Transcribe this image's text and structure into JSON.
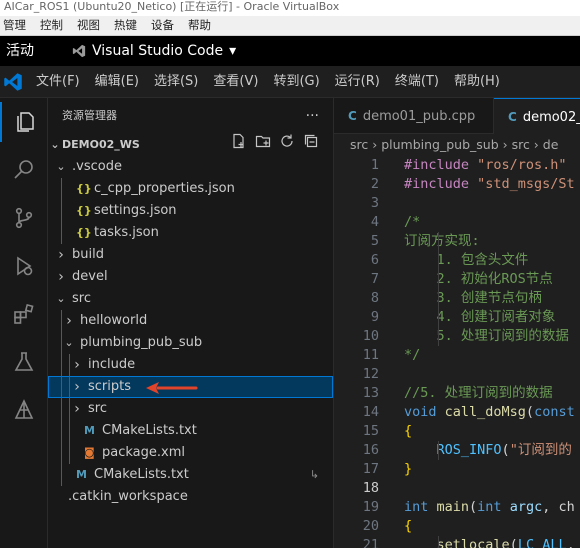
{
  "vbox": {
    "title": "AICar_ROS1 (Ubuntu20_Netico) [正在运行] - Oracle VirtualBox",
    "menu": [
      "管理",
      "控制",
      "视图",
      "热键",
      "设备",
      "帮助"
    ]
  },
  "gnome": {
    "activities": "活动",
    "app_name": "Visual Studio Code",
    "dropdown_glyph": "▾"
  },
  "menubar": [
    "文件(F)",
    "编辑(E)",
    "选择(S)",
    "查看(V)",
    "转到(G)",
    "运行(R)",
    "终端(T)",
    "帮助(H)"
  ],
  "activity_icons": [
    "explorer-icon",
    "search-icon",
    "source-control-icon",
    "run-debug-icon",
    "extensions-icon",
    "testing-icon",
    "ros-icon"
  ],
  "explorer": {
    "title": "资源管理器",
    "more": "···",
    "project": "DEMO02_WS",
    "tree": [
      {
        "name": "vscode-folder",
        "label": ".vscode",
        "kind": "folder",
        "open": true,
        "depth": 1
      },
      {
        "name": "c-cpp-properties-file",
        "label": "c_cpp_properties.json",
        "kind": "json",
        "depth": 2
      },
      {
        "name": "settings-file",
        "label": "settings.json",
        "kind": "json",
        "depth": 2
      },
      {
        "name": "tasks-file",
        "label": "tasks.json",
        "kind": "json",
        "depth": 2
      },
      {
        "name": "build-folder",
        "label": "build",
        "kind": "folder",
        "open": false,
        "depth": 1
      },
      {
        "name": "devel-folder",
        "label": "devel",
        "kind": "folder",
        "open": false,
        "depth": 1
      },
      {
        "name": "src-folder",
        "label": "src",
        "kind": "folder",
        "open": true,
        "depth": 1
      },
      {
        "name": "helloworld-folder",
        "label": "helloworld",
        "kind": "folder",
        "open": false,
        "depth": 2
      },
      {
        "name": "plumbing-pub-sub-folder",
        "label": "plumbing_pub_sub",
        "kind": "folder",
        "open": true,
        "depth": 2
      },
      {
        "name": "include-folder",
        "label": "include",
        "kind": "folder",
        "open": false,
        "depth": 3
      },
      {
        "name": "scripts-folder",
        "label": "scripts",
        "kind": "folder",
        "open": false,
        "depth": 3,
        "selected": true
      },
      {
        "name": "src-subfolder",
        "label": "src",
        "kind": "folder",
        "open": false,
        "depth": 3
      },
      {
        "name": "cmakelists-pkg-file",
        "label": "CMakeLists.txt",
        "kind": "cmake",
        "depth": 3
      },
      {
        "name": "package-xml-file",
        "label": "package.xml",
        "kind": "xml",
        "depth": 3
      },
      {
        "name": "cmakelists-src-file",
        "label": "CMakeLists.txt",
        "kind": "cmake",
        "depth": 2,
        "link": "↳"
      },
      {
        "name": "catkin-workspace-file",
        "label": ".catkin_workspace",
        "kind": "plain",
        "depth": 1
      }
    ]
  },
  "editor": {
    "tabs": [
      {
        "label": "demo01_pub.cpp",
        "icon": "C",
        "active": false
      },
      {
        "label": "demo02_",
        "icon": "C",
        "active": true
      }
    ],
    "breadcrumb": "src › plumbing_pub_sub › src › de",
    "current_line": 18,
    "lines": [
      {
        "n": 1,
        "parts": [
          [
            "#include ",
            "pp"
          ],
          [
            "\"ros/ros.h\"",
            "str"
          ]
        ]
      },
      {
        "n": 2,
        "parts": [
          [
            "#include ",
            "pp"
          ],
          [
            "\"std_msgs/St",
            "str"
          ]
        ]
      },
      {
        "n": 3,
        "parts": []
      },
      {
        "n": 4,
        "parts": [
          [
            "/*",
            "cm"
          ]
        ]
      },
      {
        "n": 5,
        "parts": [
          [
            "订阅方实现:",
            "cm"
          ]
        ]
      },
      {
        "n": 6,
        "parts": [
          [
            "    1. 包含头文件",
            "cm"
          ]
        ]
      },
      {
        "n": 7,
        "parts": [
          [
            "    2. 初始化ROS节点",
            "cm"
          ]
        ]
      },
      {
        "n": 8,
        "parts": [
          [
            "    3. 创建节点句柄",
            "cm"
          ]
        ]
      },
      {
        "n": 9,
        "parts": [
          [
            "    4. 创建订阅者对象",
            "cm"
          ]
        ]
      },
      {
        "n": 10,
        "parts": [
          [
            "    5. 处理订阅到的数据",
            "cm"
          ]
        ]
      },
      {
        "n": 11,
        "parts": [
          [
            "*/",
            "cm"
          ]
        ]
      },
      {
        "n": 12,
        "parts": []
      },
      {
        "n": 13,
        "parts": [
          [
            "//5. 处理订阅到的数据",
            "cm"
          ]
        ]
      },
      {
        "n": 14,
        "parts": [
          [
            "void ",
            "kw"
          ],
          [
            "call_doMsg",
            "fn"
          ],
          [
            "(",
            "pl"
          ],
          [
            "const",
            "kw"
          ]
        ]
      },
      {
        "n": 15,
        "parts": [
          [
            "{",
            "br"
          ]
        ]
      },
      {
        "n": 16,
        "parts": [
          [
            "    ",
            "pl"
          ],
          [
            "ROS_INFO",
            "mac"
          ],
          [
            "(",
            "pl"
          ],
          [
            "\"订阅到的",
            "str"
          ]
        ]
      },
      {
        "n": 17,
        "parts": [
          [
            "}",
            "br"
          ]
        ]
      },
      {
        "n": 18,
        "parts": []
      },
      {
        "n": 19,
        "parts": [
          [
            "int ",
            "kw"
          ],
          [
            "main",
            "fn"
          ],
          [
            "(",
            "pl"
          ],
          [
            "int ",
            "kw"
          ],
          [
            "argc",
            "var"
          ],
          [
            ", ch",
            "pl"
          ]
        ]
      },
      {
        "n": 20,
        "parts": [
          [
            "{",
            "br"
          ]
        ]
      },
      {
        "n": 21,
        "parts": [
          [
            "    ",
            "pl"
          ],
          [
            "setlocale",
            "fn"
          ],
          [
            "(",
            "pl"
          ],
          [
            "LC_ALL",
            "mac"
          ],
          [
            ",",
            "pl"
          ]
        ]
      }
    ]
  },
  "colors": {
    "accent": "#0078d4",
    "pp": "#c586c0",
    "str": "#ce9178",
    "cm": "#6a9955",
    "kw": "#569cd6",
    "fn": "#dcdcaa",
    "mac": "#4fc1ff",
    "var": "#9cdcfe",
    "pl": "#d4d4d4",
    "br": "#ffd700",
    "json": "#cbcb41",
    "cmake": "#519aba",
    "xml": "#e37933",
    "annotation": "#e0442a"
  }
}
